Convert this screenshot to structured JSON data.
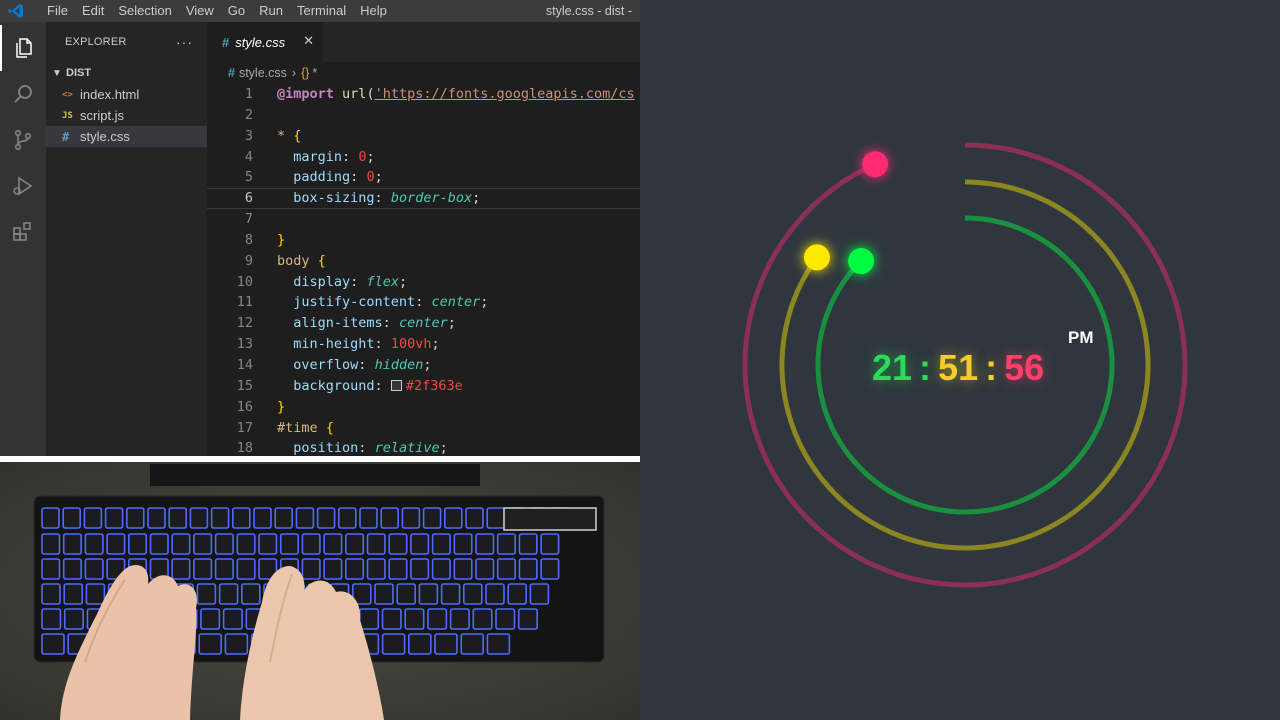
{
  "titlebar": {
    "menu": [
      "File",
      "Edit",
      "Selection",
      "View",
      "Go",
      "Run",
      "Terminal",
      "Help"
    ],
    "window_title": "style.css - dist -"
  },
  "activity_bar": [
    "files-icon",
    "search-icon",
    "source-control-icon",
    "run-debug-icon",
    "extensions-icon"
  ],
  "sidebar": {
    "title": "EXPLORER",
    "more": "···",
    "folder": "DIST",
    "files": [
      {
        "name": "index.html",
        "icon": "<>",
        "icon_color": "#e37933"
      },
      {
        "name": "script.js",
        "icon": "JS",
        "icon_color": "#cbcb41"
      },
      {
        "name": "style.css",
        "icon": "#",
        "icon_color": "#519aba",
        "selected": true
      }
    ]
  },
  "editor": {
    "tab_label": "style.css",
    "tab_close": "✕",
    "breadcrumb_file": "style.css",
    "breadcrumb_symbol": "*",
    "swatch_color": "#2f363e"
  },
  "code": {
    "lines": [
      {
        "n": "1",
        "parts": [
          {
            "t": "@import",
            "c": "at"
          },
          {
            "t": " "
          },
          {
            "t": "url",
            "c": "fn"
          },
          {
            "t": "("
          },
          {
            "t": "'https://fonts.googleapis.com/cs",
            "c": "str"
          }
        ]
      },
      {
        "n": "2",
        "parts": []
      },
      {
        "n": "3",
        "parts": [
          {
            "t": "*",
            "c": "sel"
          },
          {
            "t": " "
          },
          {
            "t": "{",
            "c": "br"
          }
        ]
      },
      {
        "n": "4",
        "parts": [
          {
            "t": "  "
          },
          {
            "t": "margin",
            "c": "prop"
          },
          {
            "t": ": "
          },
          {
            "t": "0",
            "c": "red"
          },
          {
            "t": ";"
          }
        ]
      },
      {
        "n": "5",
        "parts": [
          {
            "t": "  "
          },
          {
            "t": "padding",
            "c": "prop"
          },
          {
            "t": ": "
          },
          {
            "t": "0",
            "c": "red"
          },
          {
            "t": ";"
          }
        ]
      },
      {
        "n": "6",
        "parts": [
          {
            "t": "  "
          },
          {
            "t": "box-sizing",
            "c": "prop"
          },
          {
            "t": ": "
          },
          {
            "t": "border-box",
            "c": "val"
          },
          {
            "t": ";"
          }
        ],
        "current": true
      },
      {
        "n": "7",
        "parts": []
      },
      {
        "n": "8",
        "parts": [
          {
            "t": "}",
            "c": "br"
          }
        ]
      },
      {
        "n": "9",
        "parts": [
          {
            "t": "body",
            "c": "sel"
          },
          {
            "t": " "
          },
          {
            "t": "{",
            "c": "br"
          }
        ]
      },
      {
        "n": "10",
        "parts": [
          {
            "t": "  "
          },
          {
            "t": "display",
            "c": "prop"
          },
          {
            "t": ": "
          },
          {
            "t": "flex",
            "c": "val"
          },
          {
            "t": ";"
          }
        ]
      },
      {
        "n": "11",
        "parts": [
          {
            "t": "  "
          },
          {
            "t": "justify-content",
            "c": "prop"
          },
          {
            "t": ": "
          },
          {
            "t": "center",
            "c": "val"
          },
          {
            "t": ";"
          }
        ]
      },
      {
        "n": "12",
        "parts": [
          {
            "t": "  "
          },
          {
            "t": "align-items",
            "c": "prop"
          },
          {
            "t": ": "
          },
          {
            "t": "center",
            "c": "val"
          },
          {
            "t": ";"
          }
        ]
      },
      {
        "n": "13",
        "parts": [
          {
            "t": "  "
          },
          {
            "t": "min-height",
            "c": "prop"
          },
          {
            "t": ": "
          },
          {
            "t": "100vh",
            "c": "red"
          },
          {
            "t": ";"
          }
        ]
      },
      {
        "n": "14",
        "parts": [
          {
            "t": "  "
          },
          {
            "t": "overflow",
            "c": "prop"
          },
          {
            "t": ": "
          },
          {
            "t": "hidden",
            "c": "val"
          },
          {
            "t": ";"
          }
        ]
      },
      {
        "n": "15",
        "parts": [
          {
            "t": "  "
          },
          {
            "t": "background",
            "c": "prop"
          },
          {
            "t": ": "
          },
          {
            "t": "",
            "c": "swatch"
          },
          {
            "t": "#2f363e",
            "c": "red"
          }
        ]
      },
      {
        "n": "16",
        "parts": [
          {
            "t": "}",
            "c": "br"
          }
        ]
      },
      {
        "n": "17",
        "parts": [
          {
            "t": "#time",
            "c": "sel"
          },
          {
            "t": " "
          },
          {
            "t": "{",
            "c": "br"
          }
        ]
      },
      {
        "n": "18",
        "parts": [
          {
            "t": "  "
          },
          {
            "t": "position",
            "c": "prop"
          },
          {
            "t": ": "
          },
          {
            "t": "relative",
            "c": "val"
          },
          {
            "t": ";"
          }
        ]
      }
    ]
  },
  "clock": {
    "hours": "21",
    "minutes": "51",
    "seconds": "56",
    "separator": ":",
    "ampm": "PM",
    "hours_fraction": 0.875,
    "minutes_fraction": 0.85,
    "seconds_fraction": 0.933,
    "colors": {
      "hours": "#04fc43",
      "minutes": "#fee800",
      "seconds": "#ff2972",
      "background": "#2f363e"
    }
  }
}
